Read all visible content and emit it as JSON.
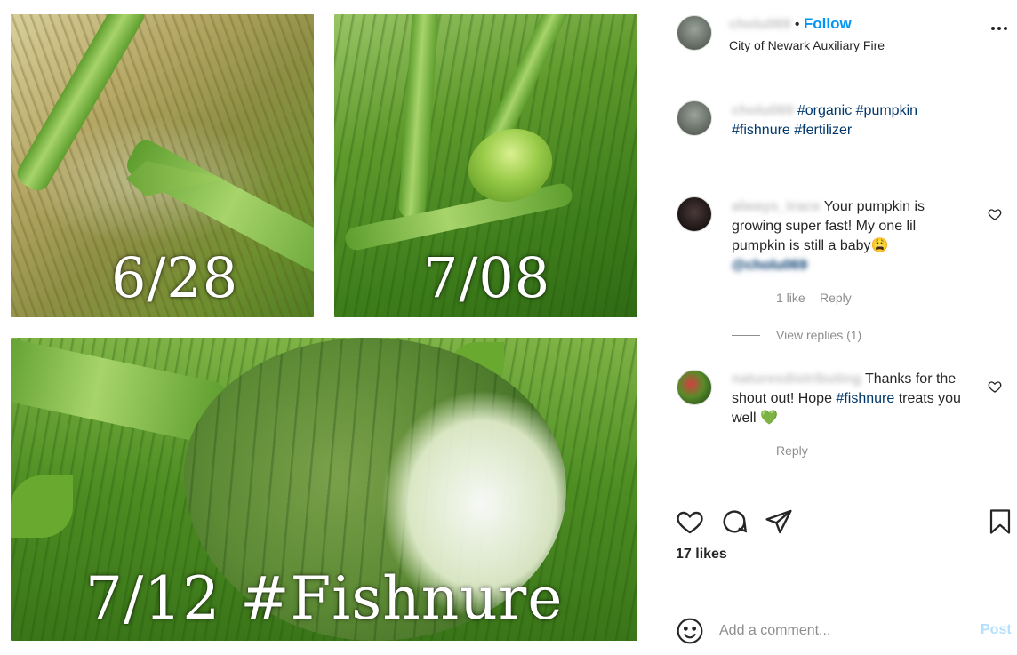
{
  "photos": {
    "label_1": "6/28",
    "label_2": "7/08",
    "label_3": "7/12 #Fishnure"
  },
  "header": {
    "username": "cholu069",
    "separator": "•",
    "follow_label": "Follow",
    "location": "City of Newark Auxiliary Fire"
  },
  "caption": {
    "username": "cholu069",
    "tag_1": "#organic",
    "tag_2": "#pumpkin",
    "tag_3": "#fishnure",
    "tag_4": "#fertilizer"
  },
  "comments": [
    {
      "username": "always_trace",
      "text": "Your pumpkin is growing super fast! My one lil pumpkin is still a baby",
      "emoji": "😩",
      "mention": "@cholu069",
      "likes": "1 like",
      "reply": "Reply",
      "view_replies": "View replies (1)"
    },
    {
      "username": "naturesdistributing",
      "text_before": "Thanks for the shout out! Hope ",
      "tag": "#fishnure",
      "text_after": " treats you well ",
      "emoji": "💚",
      "reply": "Reply"
    }
  ],
  "actions": {
    "icons": [
      "heart-icon",
      "comment-icon",
      "share-icon",
      "bookmark-icon"
    ]
  },
  "likes": "17 likes",
  "add_comment": {
    "placeholder": "Add a comment...",
    "post_label": "Post"
  },
  "colors": {
    "follow_blue": "#0095f6",
    "hashtag_blue": "#00376b",
    "muted_gray": "#8e8e8e",
    "post_disabled": "#b2dffc"
  }
}
